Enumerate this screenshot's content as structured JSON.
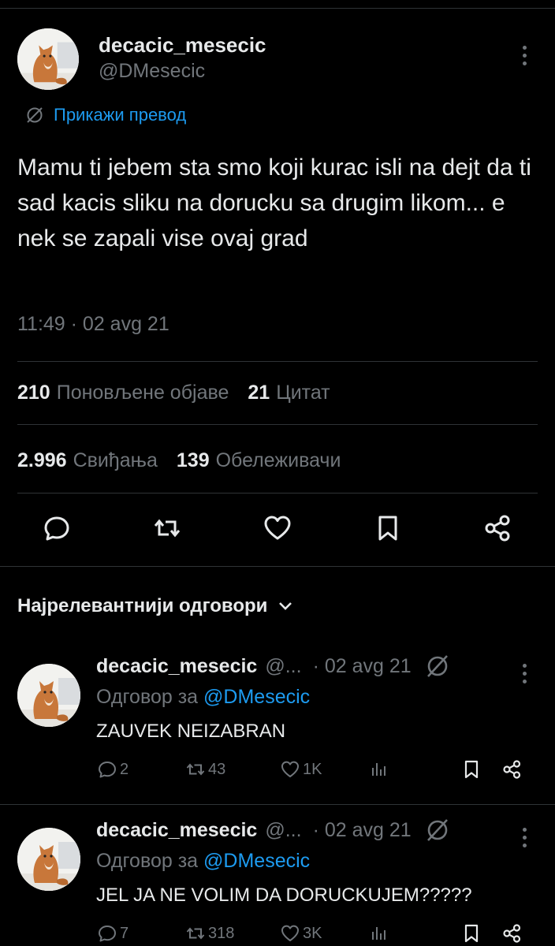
{
  "tweet": {
    "author_name": "decacic_mesecic",
    "author_handle": "@DMesecic",
    "translate_label": "Прикажи превод",
    "text": "Mamu ti jebem sta smo koji kurac isli na dejt da ti sad kacis sliku na dorucku sa drugim likom... e nek se zapali vise ovaj grad",
    "timestamp": "11:49 · 02 avg 21",
    "stats": {
      "reposts_count": "210",
      "reposts_label": "Поновљене објаве",
      "quotes_count": "21",
      "quotes_label": "Цитат",
      "likes_count": "2.996",
      "likes_label": "Свиђања",
      "bookmarks_count": "139",
      "bookmarks_label": "Обележивачи"
    }
  },
  "replies_section": {
    "sort_label": "Најрелевантнији одговори"
  },
  "replies": [
    {
      "author_name": "decacic_mesecic",
      "author_handle": "@...",
      "date": "· 02 avg 21",
      "reply_to_prefix": "Одговор за",
      "reply_to_handle": "@DMesecic",
      "text": "ZAUVEK NEIZABRAN",
      "reply_count": "2",
      "repost_count": "43",
      "like_count": "1K"
    },
    {
      "author_name": "decacic_mesecic",
      "author_handle": "@...",
      "date": "· 02 avg 21",
      "reply_to_prefix": "Одговор за",
      "reply_to_handle": "@DMesecic",
      "text": "JEL JA NE VOLIM DA DORUCKUJEM?????",
      "reply_count": "7",
      "repost_count": "318",
      "like_count": "3K"
    }
  ],
  "colors": {
    "background": "#000000",
    "text_primary": "#e7e9ea",
    "text_secondary": "#71767b",
    "accent": "#1d9bf0",
    "divider": "#2f3336"
  }
}
